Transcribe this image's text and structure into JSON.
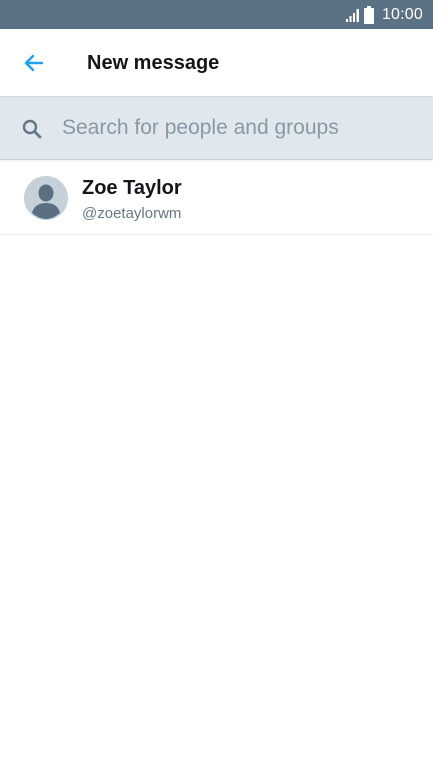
{
  "status_bar": {
    "time": "10:00",
    "signal_icon": "signal-icon",
    "battery_icon": "battery-icon"
  },
  "header": {
    "back_icon": "arrow-left-icon",
    "title": "New message"
  },
  "search": {
    "icon": "search-icon",
    "placeholder": "Search for people and groups",
    "value": ""
  },
  "results": [
    {
      "name": "Zoe Taylor",
      "handle": "@zoetaylorwm",
      "avatar_icon": "default-avatar-icon"
    }
  ],
  "colors": {
    "status_bar_bg": "#5b7184",
    "accent": "#1da1f2",
    "search_bar_bg": "#e1e8ed",
    "placeholder": "#8899a6",
    "primary_text": "#14171a",
    "secondary_text": "#657786"
  }
}
